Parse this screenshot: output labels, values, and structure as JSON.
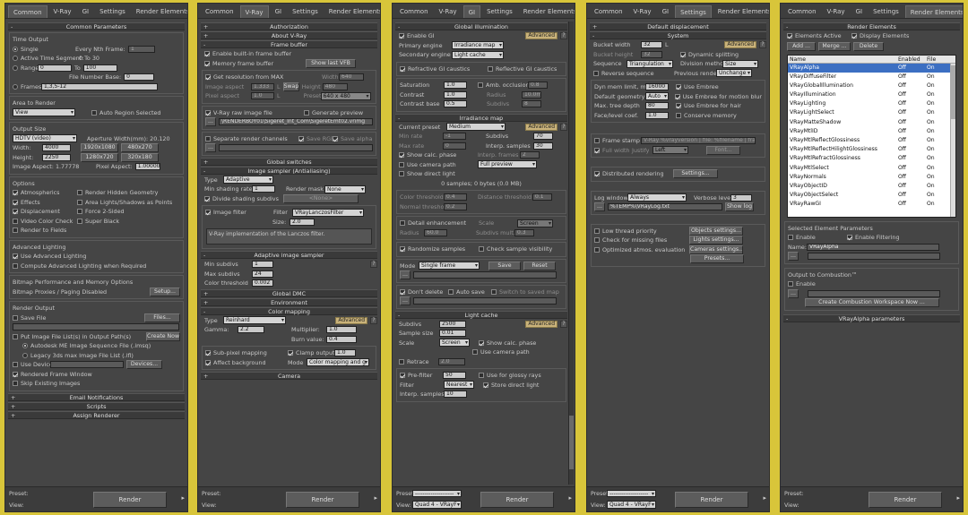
{
  "tabs": [
    "Common",
    "V-Ray",
    "GI",
    "Settings",
    "Render Elements"
  ],
  "bottom": {
    "preset_label": "Preset:",
    "view_label": "View:",
    "preset_value": "--------------------",
    "view_value": "Quad 4 - VRayF",
    "render_label": "Render"
  },
  "p1": {
    "rollouts": [
      "Common Parameters",
      "Email Notifications",
      "Scripts",
      "Assign Renderer"
    ],
    "time_output": "Time Output",
    "single": "Single",
    "every_nth": "Every Nth Frame:",
    "every_nth_val": "1",
    "active_seg": "Active Time Segment:",
    "active_range": "0 To 30",
    "range": "Range:",
    "range_from": "0",
    "to": "To",
    "range_to": "100",
    "file_num_base": "File Number Base:",
    "file_num_val": "0",
    "frames": "Frames",
    "frames_val": "1,3,5-12",
    "area": "Area to Render",
    "area_val": "View",
    "auto_region": "Auto Region Selected",
    "output_size": "Output Size",
    "size_preset": "HDTV (video)",
    "aperture": "Aperture Width(mm): 20.120",
    "width": "Width:",
    "width_val": "4000",
    "height": "Height:",
    "height_val": "2250",
    "res": [
      "1920x1080",
      "480x270",
      "1280x720",
      "320x180"
    ],
    "img_aspect": "Image Aspect: 1.77778",
    "pix_aspect": "Pixel Aspect:",
    "pix_aspect_val": "1.00000",
    "options": "Options",
    "opt": [
      "Atmospherics",
      "Render Hidden Geometry",
      "Effects",
      "Area Lights/Shadows as Points",
      "Displacement",
      "Force 2-Sided",
      "Video Color Check",
      "Super Black",
      "Render to Fields"
    ],
    "adv_light": "Advanced Lighting",
    "use_adv": "Use Advanced Lighting",
    "compute_adv": "Compute Advanced Lighting when Required",
    "bitmap": "Bitmap Performance and Memory Options",
    "bitmap_proxies": "Bitmap Proxies / Paging Disabled",
    "setup": "Setup...",
    "render_output": "Render Output",
    "save_file": "Save File",
    "files": "Files...",
    "put_image": "Put Image File List(s) in Output Path(s)",
    "create_now": "Create Now",
    "autodesk_seq": "Autodesk ME Image Sequence File (.imsq)",
    "legacy": "Legacy 3ds max Image File List (.ifl)",
    "use_device": "Use Device",
    "devices": "Devices...",
    "rendered_window": "Rendered Frame Window",
    "skip_existing": "Skip Existing Images"
  },
  "p2": {
    "rollouts": [
      "Authorization",
      "About V-Ray",
      "Frame buffer",
      "Global switches",
      "Image sampler (Antialiasing)",
      "Adaptive image sampler",
      "Global DMC",
      "Environment",
      "Color mapping",
      "Camera"
    ],
    "enable_fb": "Enable built-in frame buffer",
    "mem_fb": "Memory frame buffer",
    "show_vfb": "Show last VFB",
    "get_res": "Get resolution from MAX",
    "width": "Width",
    "width_val": "640",
    "img_aspect": "Image aspect",
    "img_aspect_val": "1.333",
    "height": "Height",
    "height_val": "480",
    "pix_aspect": "Pixel aspect",
    "pix_aspect_val": "1.0",
    "swap": "Swap",
    "preset": "Preset",
    "preset_val": "640 x 480",
    "l": "L",
    "raw": "V-Ray raw image file",
    "gen_preview": "Generate preview",
    "raw_path": "\\RENDERBOY01\\Sigeret_Int_Com\\SigeretEmt02.vrimg",
    "sep_channels": "Separate render channels",
    "save_rgb": "Save RGB",
    "save_alpha": "Save alpha",
    "type": "Type",
    "type_val": "Adaptive",
    "min_shading": "Min shading rate",
    "min_shading_val": "1",
    "render_mask": "Render mask",
    "render_mask_val": "None",
    "divide": "Divide shading subdivs",
    "none_btn": "<None>",
    "image_filter": "Image filter",
    "filter": "Filter",
    "filter_val": "VRayLanczosFilter",
    "size": "Size:",
    "size_val": "2.0",
    "filter_desc": "V-Ray implementation of the Lanczos filter.",
    "min_subdivs": "Min subdivs",
    "min_subdivs_val": "1",
    "max_subdivs": "Max subdivs",
    "max_subdivs_val": "24",
    "color_thresh": "Color threshold",
    "color_thresh_val": "0.002",
    "cm_type": "Type",
    "cm_type_val": "Reinhard",
    "advanced": "Advanced",
    "gamma": "Gamma:",
    "gamma_val": "2.2",
    "multiplier": "Multiplier:",
    "multiplier_val": "1.0",
    "burn": "Burn value:",
    "burn_val": "0.4",
    "subpixel": "Sub-pixel mapping",
    "clamp": "Clamp output",
    "clamp_val": "1.0",
    "affect_bg": "Affect background",
    "mode": "Mode",
    "mode_val": "Color mapping and g"
  },
  "p3": {
    "rollouts": [
      "Global illumination",
      "Irradiance map",
      "Light cache"
    ],
    "enable_gi": "Enable GI",
    "advanced": "Advanced",
    "primary": "Primary engine",
    "primary_val": "Irradiance map",
    "secondary": "Secondary engine",
    "secondary_val": "Light cache",
    "refractive": "Refractive GI caustics",
    "reflective": "Reflective GI caustics",
    "saturation": "Saturation",
    "saturation_val": "1.0",
    "contrast": "Contrast",
    "contrast_val": "1.0",
    "contrast_base": "Contrast base",
    "contrast_base_val": "0.5",
    "amb_occ": "Amb. occlusion",
    "amb_occ_val": "0.8",
    "radius": "Radius",
    "radius_val": "10.0m",
    "subdivs": "Subdivs",
    "subdivs_val": "8",
    "current_preset": "Current preset",
    "current_preset_val": "Medium",
    "min_rate": "Min rate",
    "min_rate_val": "-1",
    "max_rate": "Max rate",
    "max_rate_val": "0",
    "irr_subdivs": "Subdivs",
    "irr_subdivs_val": "70",
    "interp_samples": "Interp. samples",
    "interp_samples_val": "30",
    "interp_frames": "Interp. frames",
    "interp_frames_val": "2",
    "show_calc": "Show calc. phase",
    "use_camera": "Use camera path",
    "show_direct": "Show direct light",
    "full_preview": "Full preview",
    "samples_info": "0 samples; 0 bytes (0.0 MB)",
    "color_thresh": "Color threshold",
    "color_thresh_val": "0.4",
    "normal_thresh": "Normal threshold",
    "normal_thresh_val": "0.2",
    "dist_thresh": "Distance threshold",
    "dist_thresh_val": "0.1",
    "detail": "Detail enhancement",
    "scale": "Scale",
    "scale_val": "Screen",
    "radius2": "Radius",
    "radius2_val": "60.0",
    "subdivs_mult": "Subdivs mult.",
    "subdivs_mult_val": "0.3",
    "randomize": "Randomize samples",
    "check_vis": "Check sample visibility",
    "mode": "Mode",
    "mode_val": "Single frame",
    "save": "Save",
    "reset": "Reset",
    "dont_delete": "Don't delete",
    "auto_save": "Auto save",
    "switch_saved": "Switch to saved map",
    "lc_subdivs": "Subdivs",
    "lc_subdivs_val": "2500",
    "sample_size": "Sample size",
    "sample_size_val": "0.01",
    "lc_scale": "Scale",
    "lc_scale_val": "Screen",
    "lc_show_calc": "Show calc. phase",
    "lc_use_camera": "Use camera path",
    "retrace": "Retrace",
    "retrace_val": "2.0",
    "prefilter": "Pre-filter",
    "prefilter_val": "50",
    "use_glossy": "Use for glossy rays",
    "lc_filter": "Filter",
    "lc_filter_val": "Nearest",
    "store_direct": "Store direct light",
    "lc_interp": "Interp. samples",
    "lc_interp_val": "10"
  },
  "p4": {
    "rollouts": [
      "Default displacement",
      "System"
    ],
    "bucket_width": "Bucket width",
    "bucket_width_val": "32",
    "bucket_height": "Bucket height",
    "bucket_height_val": "32",
    "l": "L",
    "advanced": "Advanced",
    "dynamic_split": "Dynamic splitting",
    "sequence": "Sequence",
    "sequence_val": "Triangulation",
    "division": "Division method",
    "division_val": "Size",
    "reverse": "Reverse sequence",
    "prev_render": "Previous render",
    "prev_render_val": "Unchange",
    "dyn_mem": "Dyn mem limit, mb",
    "dyn_mem_val": "16000",
    "def_geom": "Default geometry",
    "def_geom_val": "Auto",
    "max_tree": "Max. tree depth",
    "max_tree_val": "80",
    "face_coef": "Face/level coef.",
    "face_coef_val": "1.0",
    "use_embree": "Use Embree",
    "embree_motion": "Use Embree for motion blur",
    "embree_hair": "Use Embree for hair",
    "conserve": "Conserve memory",
    "frame_stamp": "Frame stamp",
    "stamp_text": "V-Ray %vrayversion | file: %filename | frame:",
    "full_width": "Full width",
    "justify": "Justify",
    "justify_val": "Left",
    "font": "Font...",
    "distributed": "Distributed rendering",
    "settings": "Settings...",
    "log_window": "Log window",
    "log_val": "Always",
    "verbose": "Verbose level",
    "verbose_val": "3",
    "log_path": "%TEMP%\\VRayLog.txt",
    "show_log": "Show log",
    "low_thread": "Low thread priority",
    "check_missing": "Check for missing files",
    "optimized": "Optimized atmos. evaluation",
    "objects_settings": "Objects settings...",
    "lights_settings": "Lights settings...",
    "cameras_settings": "Cameras settings...",
    "presets": "Presets..."
  },
  "p5": {
    "rollouts": [
      "Render Elements",
      "VRayAlpha parameters"
    ],
    "elements_active": "Elements Active",
    "display_elements": "Display Elements",
    "add": "Add ...",
    "merge": "Merge ...",
    "delete": "Delete",
    "cols": [
      "Name",
      "Enabled",
      "File"
    ],
    "items": [
      [
        "VRayAlpha",
        "Off",
        "On"
      ],
      [
        "VRayDiffuseFilter",
        "Off",
        "On"
      ],
      [
        "VRayGlobalIllumination",
        "Off",
        "On"
      ],
      [
        "VRayIllumination",
        "Off",
        "On"
      ],
      [
        "VRayLighting",
        "Off",
        "On"
      ],
      [
        "VRayLightSelect",
        "Off",
        "On"
      ],
      [
        "VRayMatteShadow",
        "Off",
        "On"
      ],
      [
        "VRayMtlID",
        "Off",
        "On"
      ],
      [
        "VRayMtlReflectGlossiness",
        "Off",
        "On"
      ],
      [
        "VRayMtlReflectHilightGlossiness",
        "Off",
        "On"
      ],
      [
        "VRayMtlRefractGlossiness",
        "Off",
        "On"
      ],
      [
        "VRayMtlSelect",
        "Off",
        "On"
      ],
      [
        "VRayNormals",
        "Off",
        "On"
      ],
      [
        "VRayObjectID",
        "Off",
        "On"
      ],
      [
        "VRayObjectSelect",
        "Off",
        "On"
      ],
      [
        "VRayRawGI",
        "Off",
        "On"
      ]
    ],
    "selected_params": "Selected Element Parameters",
    "enable": "Enable",
    "enable_filtering": "Enable Filtering",
    "name": "Name:",
    "name_val": "VRayAlpha",
    "dots": "...",
    "combustion": "Output to Combustion™",
    "comb_enable": "Enable",
    "create_ws": "Create Combustion Workspace Now ..."
  }
}
